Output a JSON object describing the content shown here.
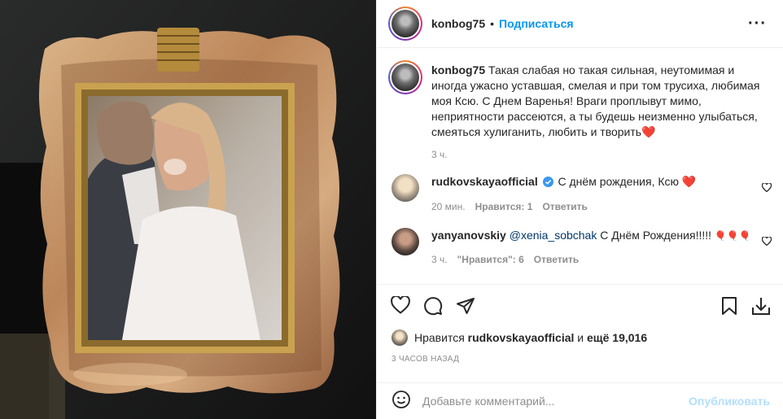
{
  "header": {
    "username": "konbog75",
    "separator": "•",
    "follow_label": "Подписаться",
    "more_label": "···"
  },
  "caption": {
    "username": "konbog75",
    "text": "Такая слабая но такая сильная, неутомимая и иногда ужасно уставшая, смелая и при том трусиха, любимая моя Ксю. С Днем Варенья! Враги проплывут мимо, неприятности рассеются, а ты будешь неизменно улыбаться, смеяться хулиганить, любить и творить",
    "emoji": "❤️",
    "time": "3 ч."
  },
  "comments": [
    {
      "username": "rudkovskayaofficial",
      "verified": true,
      "text": "С днём рождения, Ксю",
      "emoji": "❤️",
      "time": "20 мин.",
      "likes_label": "Нравится: 1",
      "reply_label": "Ответить"
    },
    {
      "username": "yanyanovskiy",
      "mention": "@xenia_sobchak",
      "text": "С Днём Рождения!!!!!",
      "emoji": "🎈🎈🎈",
      "time": "3 ч.",
      "likes_label": "\"Нравится\": 6",
      "reply_label": "Ответить"
    }
  ],
  "likes": {
    "prefix": "Нравится",
    "user": "rudkovskayaofficial",
    "and": "и",
    "others": "ещё 19,016"
  },
  "timestamp": "3 ЧАСОВ НАЗАД",
  "comment_input": {
    "placeholder": "Добавьте комментарий...",
    "post_label": "Опубликовать"
  },
  "icons": {
    "like": "heart-icon",
    "comment": "comment-icon",
    "share": "share-icon",
    "save": "bookmark-icon",
    "download": "download-icon",
    "emoji": "emoji-icon"
  },
  "colors": {
    "accent": "#0095f6",
    "post_disabled": "#b2dffc",
    "heart": "#ed4956",
    "verified": "#3897f0"
  }
}
